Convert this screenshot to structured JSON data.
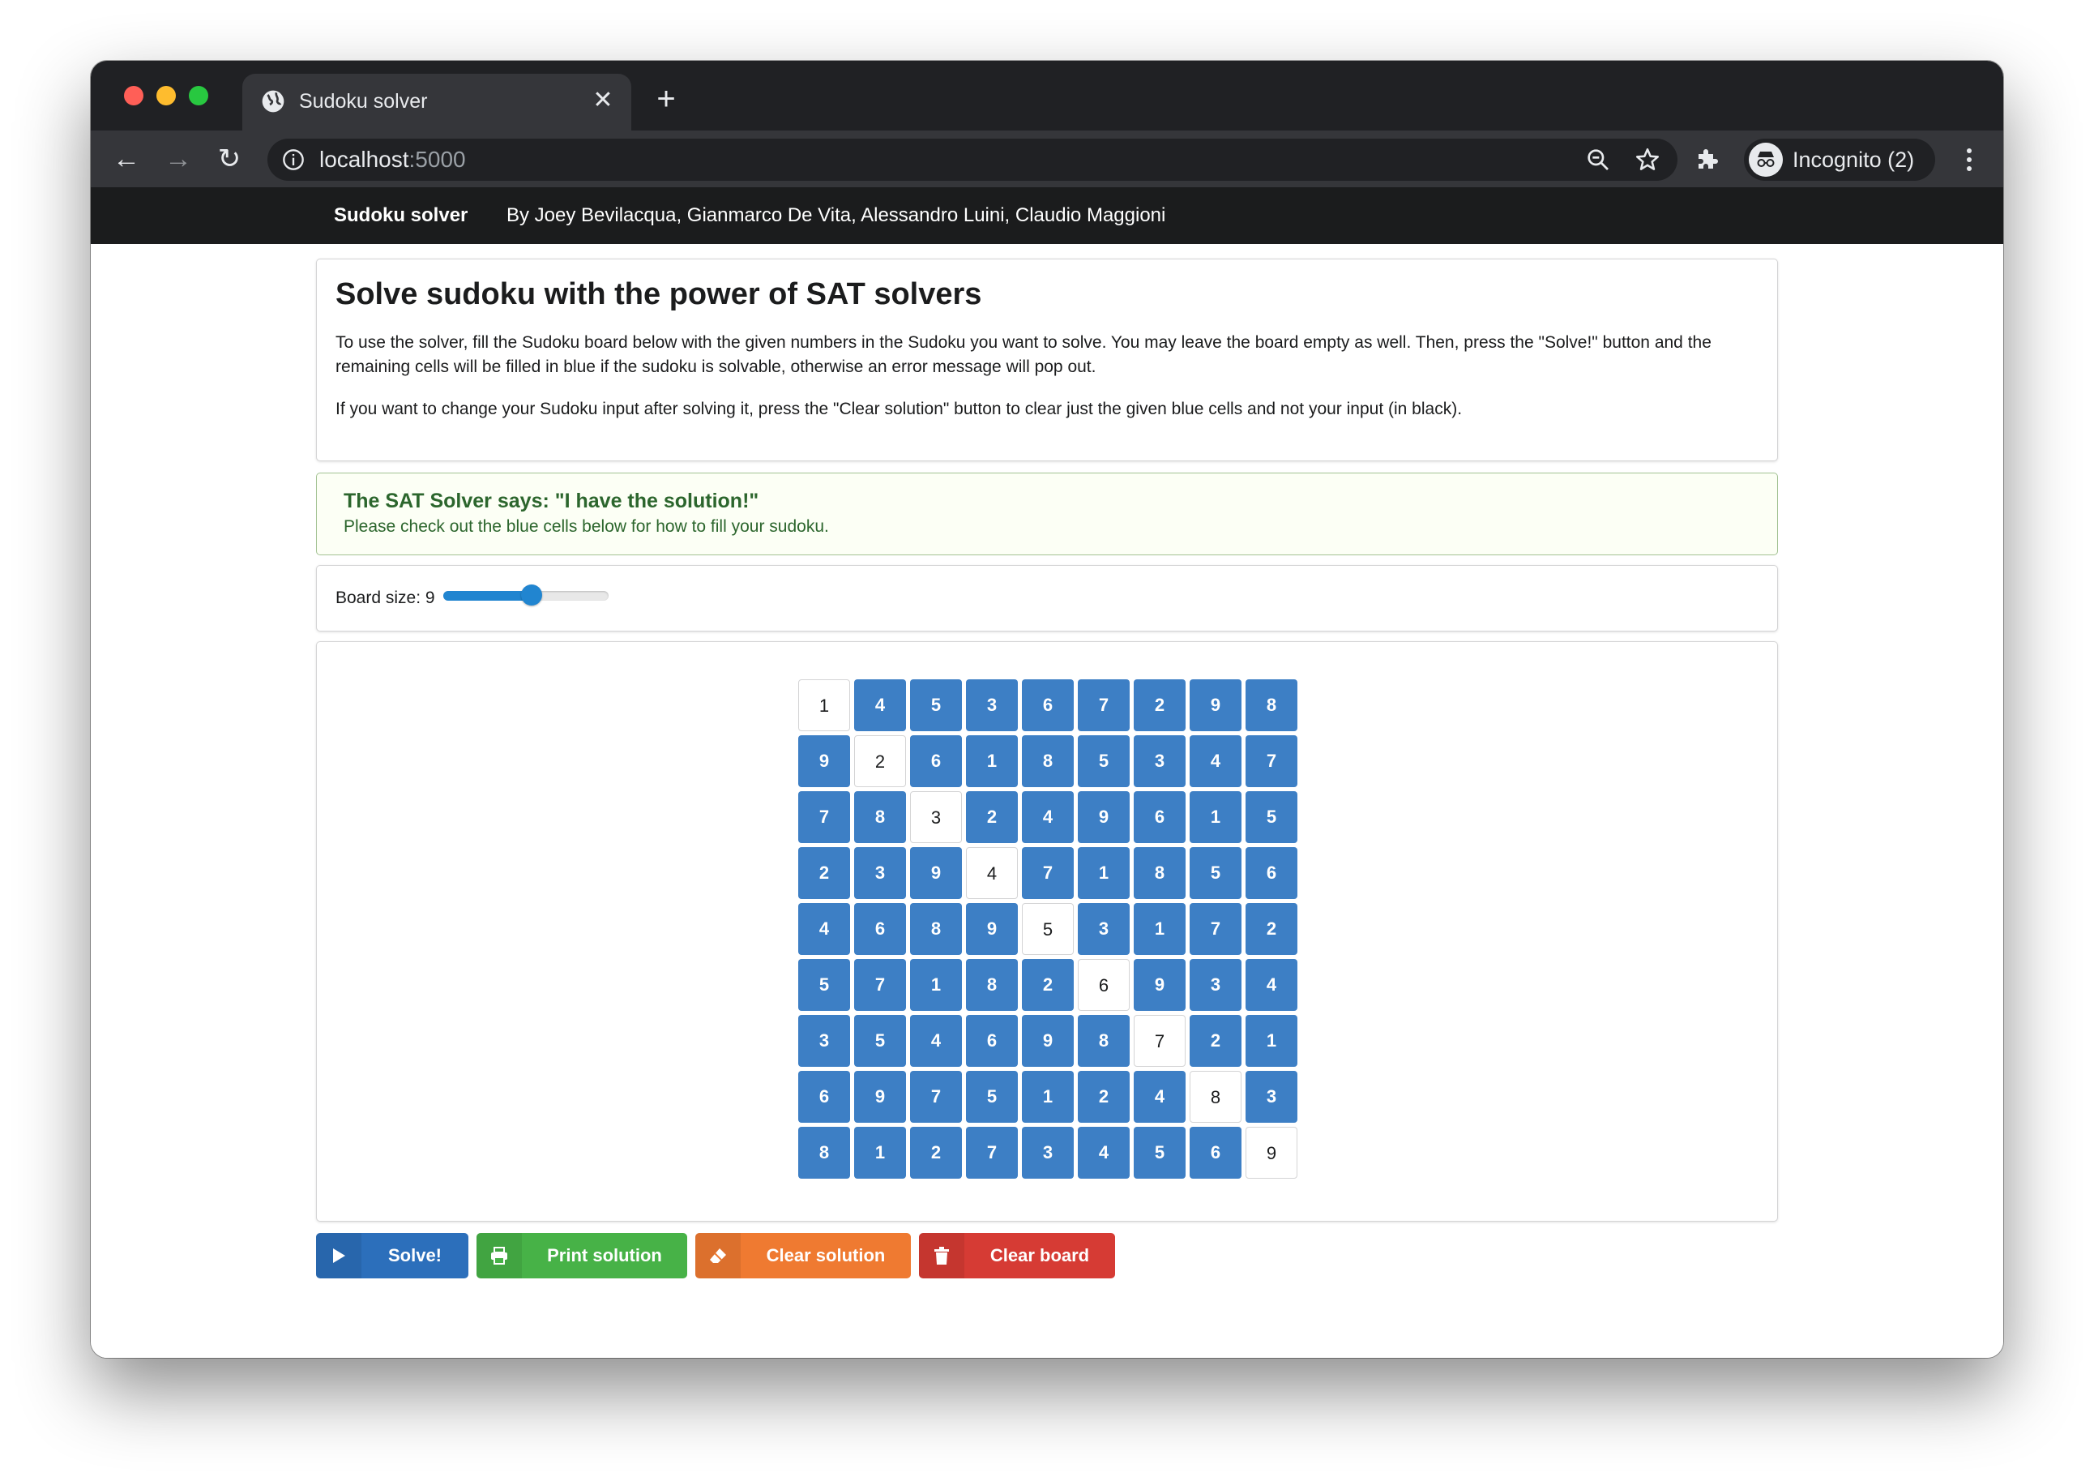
{
  "browser": {
    "tab_title": "Sudoku solver",
    "url_host": "localhost",
    "url_port": ":5000",
    "profile_label": "Incognito (2)"
  },
  "navbar": {
    "brand": "Sudoku solver",
    "authors": "By Joey Bevilacqua, Gianmarco De Vita, Alessandro Luini, Claudio Maggioni"
  },
  "intro": {
    "title": "Solve sudoku with the power of SAT solvers",
    "paragraph1": "To use the solver, fill the Sudoku board below with the given numbers in the Sudoku you want to solve. You may leave the board empty as well. Then, press the \"Solve!\" button and the remaining cells will be filled in blue if the sudoku is solvable, otherwise an error message will pop out.",
    "paragraph2": "If you want to change your Sudoku input after solving it, press the \"Clear solution\" button to clear just the given blue cells and not your input (in black)."
  },
  "message": {
    "header": "The SAT Solver says: \"I have the solution!\"",
    "text": "Please check out the blue cells below for how to fill your sudoku."
  },
  "board_size": {
    "label": "Board size: 9",
    "value": 9,
    "min": 1,
    "max": 16
  },
  "colors": {
    "solved_cell": "#3d7fc5",
    "given_cell": "#ffffff",
    "solve_button": "#2c6fbb",
    "print_button": "#47b247",
    "clear_solution_button": "#ef7a31",
    "clear_board_button": "#d63b34",
    "success_text": "#2c662d"
  },
  "board": {
    "values": [
      [
        1,
        4,
        5,
        3,
        6,
        7,
        2,
        9,
        8
      ],
      [
        9,
        2,
        6,
        1,
        8,
        5,
        3,
        4,
        7
      ],
      [
        7,
        8,
        3,
        2,
        4,
        9,
        6,
        1,
        5
      ],
      [
        2,
        3,
        9,
        4,
        7,
        1,
        8,
        5,
        6
      ],
      [
        4,
        6,
        8,
        9,
        5,
        3,
        1,
        7,
        2
      ],
      [
        5,
        7,
        1,
        8,
        2,
        6,
        9,
        3,
        4
      ],
      [
        3,
        5,
        4,
        6,
        9,
        8,
        7,
        2,
        1
      ],
      [
        6,
        9,
        7,
        5,
        1,
        2,
        4,
        8,
        3
      ],
      [
        8,
        1,
        2,
        7,
        3,
        4,
        5,
        6,
        9
      ]
    ],
    "given": [
      [
        1,
        0,
        0,
        0,
        0,
        0,
        0,
        0,
        0
      ],
      [
        0,
        1,
        0,
        0,
        0,
        0,
        0,
        0,
        0
      ],
      [
        0,
        0,
        1,
        0,
        0,
        0,
        0,
        0,
        0
      ],
      [
        0,
        0,
        0,
        1,
        0,
        0,
        0,
        0,
        0
      ],
      [
        0,
        0,
        0,
        0,
        1,
        0,
        0,
        0,
        0
      ],
      [
        0,
        0,
        0,
        0,
        0,
        1,
        0,
        0,
        0
      ],
      [
        0,
        0,
        0,
        0,
        0,
        0,
        1,
        0,
        0
      ],
      [
        0,
        0,
        0,
        0,
        0,
        0,
        0,
        1,
        0
      ],
      [
        0,
        0,
        0,
        0,
        0,
        0,
        0,
        0,
        1
      ]
    ]
  },
  "buttons": {
    "solve": {
      "label": "Solve!",
      "icon": "play-icon"
    },
    "print": {
      "label": "Print solution",
      "icon": "printer-icon"
    },
    "clear_solution": {
      "label": "Clear solution",
      "icon": "eraser-icon"
    },
    "clear_board": {
      "label": "Clear board",
      "icon": "trash-icon"
    }
  }
}
